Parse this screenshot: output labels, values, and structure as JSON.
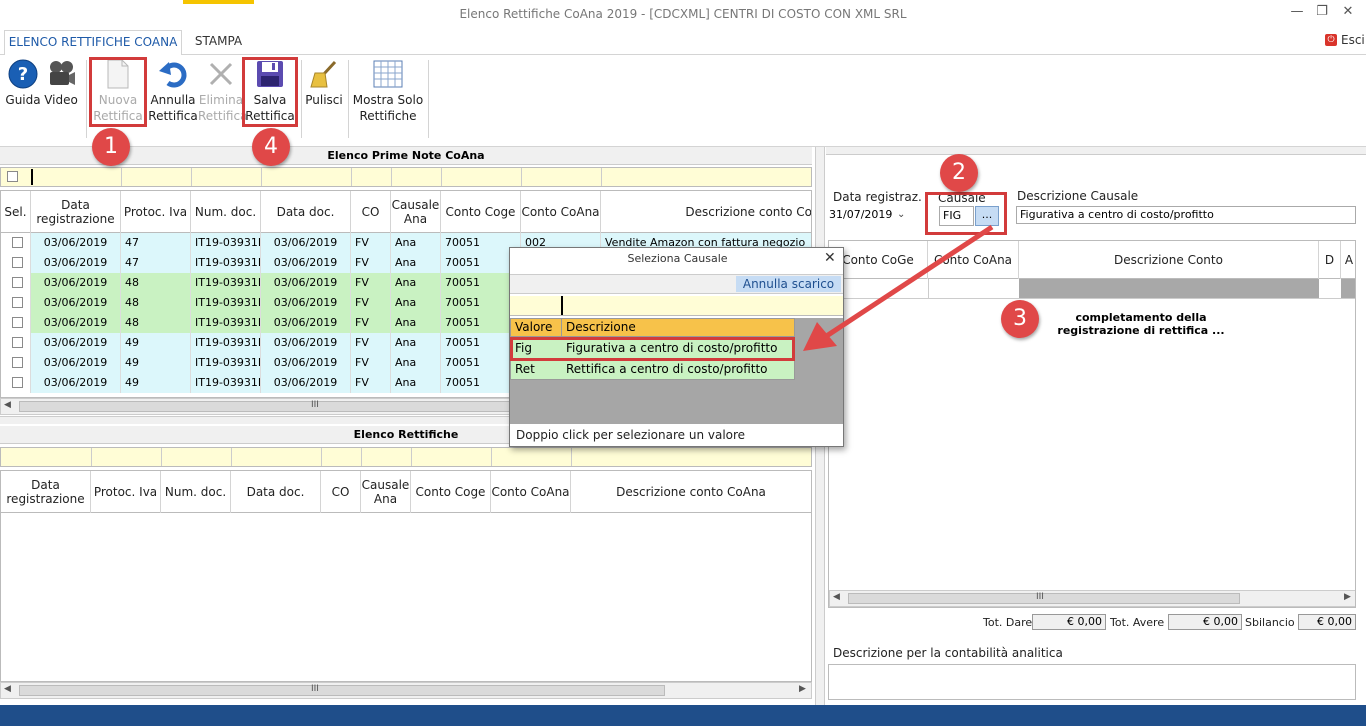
{
  "window": {
    "title": "Elenco Rettifiche CoAna 2019 - [CDCXML] CENTRI DI COSTO CON XML SRL",
    "exit_label": "Esci"
  },
  "tabs": [
    {
      "label": "ELENCO RETTIFICHE COANA"
    },
    {
      "label": "STAMPA"
    }
  ],
  "ribbon": {
    "guida": "Guida",
    "video": "Video",
    "nuova_1": "Nuova",
    "nuova_2": "Rettifica",
    "annulla_1": "Annulla",
    "annulla_2": "Rettifica",
    "elimina_1": "Elimina",
    "elimina_2": "Rettifica",
    "salva_1": "Salva",
    "salva_2": "Rettifica",
    "pulisci": "Pulisci",
    "mostra_1": "Mostra Solo",
    "mostra_2": "Rettifiche"
  },
  "badges": [
    "1",
    "2",
    "3",
    "4"
  ],
  "prime_note": {
    "title": "Elenco Prime Note CoAna",
    "columns": [
      "Sel.",
      "Data registrazione",
      "Protoc. Iva",
      "Num. doc.",
      "Data doc.",
      "CO",
      "Causale Ana",
      "Conto Coge",
      "Conto CoAna",
      "Descrizione conto Co"
    ],
    "rows": [
      {
        "data": "03/06/2019",
        "prot": "47",
        "num": "IT19-03931I-",
        "datadoc": "03/06/2019",
        "co": "FV",
        "caus": "Ana",
        "coge": "70051",
        "coana": "002",
        "desc": "Vendite Amazon con fattura negozio"
      },
      {
        "data": "03/06/2019",
        "prot": "47",
        "num": "IT19-03931I-",
        "datadoc": "03/06/2019",
        "co": "FV",
        "caus": "Ana",
        "coge": "70051",
        "coana": "",
        "desc": ""
      },
      {
        "data": "03/06/2019",
        "prot": "48",
        "num": "IT19-03931I-",
        "datadoc": "03/06/2019",
        "co": "FV",
        "caus": "Ana",
        "coge": "70051",
        "coana": "",
        "desc": ""
      },
      {
        "data": "03/06/2019",
        "prot": "48",
        "num": "IT19-03931I-",
        "datadoc": "03/06/2019",
        "co": "FV",
        "caus": "Ana",
        "coge": "70051",
        "coana": "",
        "desc": ""
      },
      {
        "data": "03/06/2019",
        "prot": "48",
        "num": "IT19-03931I-",
        "datadoc": "03/06/2019",
        "co": "FV",
        "caus": "Ana",
        "coge": "70051",
        "coana": "",
        "desc": ""
      },
      {
        "data": "03/06/2019",
        "prot": "49",
        "num": "IT19-03931I-",
        "datadoc": "03/06/2019",
        "co": "FV",
        "caus": "Ana",
        "coge": "70051",
        "coana": "",
        "desc": ""
      },
      {
        "data": "03/06/2019",
        "prot": "49",
        "num": "IT19-03931I-",
        "datadoc": "03/06/2019",
        "co": "FV",
        "caus": "Ana",
        "coge": "70051",
        "coana": "",
        "desc": ""
      },
      {
        "data": "03/06/2019",
        "prot": "49",
        "num": "IT19-03931I-",
        "datadoc": "03/06/2019",
        "co": "FV",
        "caus": "Ana",
        "coge": "70051",
        "coana": "",
        "desc": ""
      }
    ],
    "scroll_grip": "III"
  },
  "rettifiche": {
    "title": "Elenco Rettifiche",
    "columns": [
      "Data registrazione",
      "Protoc. Iva",
      "Num. doc.",
      "Data doc.",
      "CO",
      "Causale Ana",
      "Conto Coge",
      "Conto CoAna",
      "Descrizione conto CoAna"
    ],
    "scroll_grip": "III"
  },
  "popup": {
    "title": "Seleziona Causale",
    "annulla": "Annulla scarico",
    "col_valore": "Valore",
    "col_descr": "Descrizione",
    "items": [
      {
        "valore": "Fig",
        "descr": "Figurativa a centro di costo/profitto"
      },
      {
        "valore": "Ret",
        "descr": "Rettifica a centro di costo/profitto"
      }
    ],
    "footer": "Doppio click per selezionare un valore"
  },
  "right": {
    "data_label": "Data registraz.",
    "data_value": "31/07/2019",
    "causale_label": "Causale",
    "causale_value": "FIG",
    "causale_btn": "...",
    "desc_label": "Descrizione Causale",
    "desc_value": "Figurativa a centro di costo/profitto",
    "grid_cols": [
      "Conto CoGe",
      "Conto CoAna",
      "Descrizione Conto",
      "D",
      "A"
    ],
    "note_1": "completamento della",
    "note_2": "registrazione di rettifica ...",
    "tot_dare_label": "Tot. Dare",
    "tot_dare": "€ 0,00",
    "tot_avere_label": "Tot.  Avere",
    "tot_avere": "€ 0,00",
    "sbilancio_label": "Sbilancio",
    "sbilancio": "€ 0,00",
    "desc_ana_label": "Descrizione per la contabilità analitica",
    "scroll_grip": "III"
  },
  "colors": {
    "row_cyan": "#dcf7fb",
    "row_green": "#c9f2c2",
    "accent_red": "#e04848",
    "status_blue": "#1f4e8a"
  }
}
